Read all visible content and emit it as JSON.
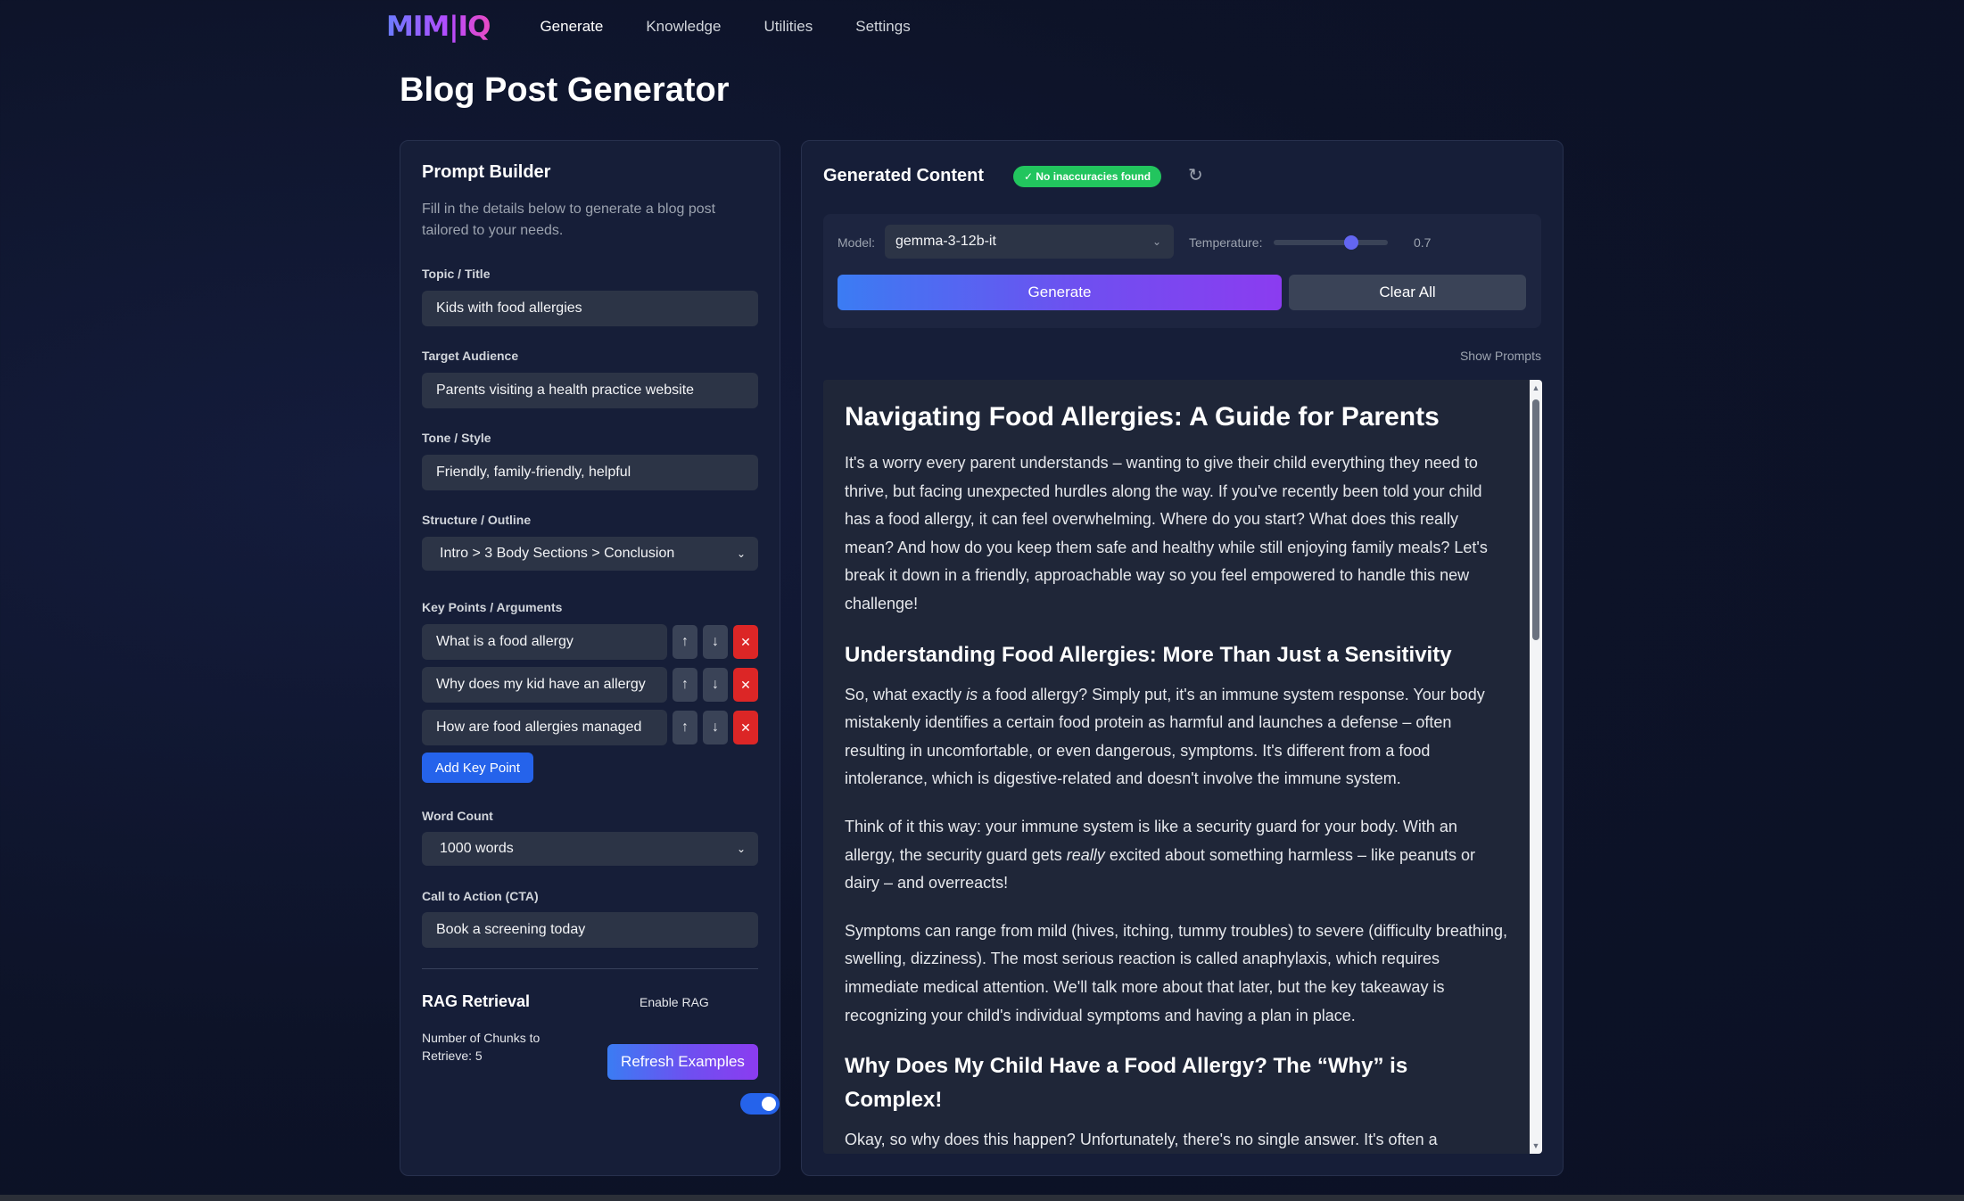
{
  "nav": {
    "logo": "MIM|IQ",
    "items": [
      "Generate",
      "Knowledge",
      "Utilities",
      "Settings"
    ]
  },
  "page_title": "Blog Post Generator",
  "prompt_builder": {
    "title": "Prompt Builder",
    "description": "Fill in the details below to generate a blog post tailored to your needs.",
    "topic_label": "Topic / Title",
    "topic_value": "Kids with food allergies",
    "audience_label": "Target Audience",
    "audience_value": "Parents visiting a health practice website",
    "tone_label": "Tone / Style",
    "tone_value": "Friendly, family-friendly, helpful",
    "structure_label": "Structure / Outline",
    "structure_value": "Intro > 3 Body Sections > Conclusion",
    "keypoints_label": "Key Points / Arguments",
    "keypoints": [
      "What is a food allergy",
      "Why does my kid have an allergy",
      "How are food allergies managed"
    ],
    "add_keypoint_label": "Add Key Point",
    "wordcount_label": "Word Count",
    "wordcount_value": "1000 words",
    "cta_label": "Call to Action (CTA)",
    "cta_value": "Book a screening today"
  },
  "rag": {
    "title": "RAG Retrieval",
    "enable_label": "Enable RAG",
    "enabled": true,
    "chunks_label": "Number of Chunks to Retrieve: 5",
    "chunks_value": 5,
    "refresh_label": "Refresh Examples"
  },
  "generated": {
    "title": "Generated Content",
    "badge": "✓ No inaccuracies found",
    "model_label": "Model:",
    "model_value": "gemma-3-12b-it",
    "temperature_label": "Temperature:",
    "temperature_value": "0.7",
    "generate_label": "Generate",
    "clear_label": "Clear All",
    "show_prompts_label": "Show Prompts"
  },
  "article": {
    "h1": "Navigating Food Allergies: A Guide for Parents",
    "p1": "It's a worry every parent understands – wanting to give their child everything they need to thrive, but facing unexpected hurdles along the way. If you've recently been told your child has a food allergy, it can feel overwhelming. Where do you start? What does this really mean? And how do you keep them safe and healthy while still enjoying family meals? Let's break it down in a friendly, approachable way so you feel empowered to handle this new challenge!",
    "h2a": "Understanding Food Allergies: More Than Just a Sensitivity",
    "p2_pre": "So, what exactly ",
    "p2_em": "is",
    "p2_post": " a food allergy? Simply put, it's an immune system response. Your body mistakenly identifies a certain food protein as harmful and launches a defense – often resulting in uncomfortable, or even dangerous, symptoms. It's different from a food intolerance, which is digestive-related and doesn't involve the immune system.",
    "p3_pre": "Think of it this way: your immune system is like a security guard for your body. With an allergy, the security guard gets ",
    "p3_em": "really",
    "p3_post": " excited about something harmless – like peanuts or dairy – and overreacts!",
    "p4": "Symptoms can range from mild (hives, itching, tummy troubles) to severe (difficulty breathing, swelling, dizziness). The most serious reaction is called anaphylaxis, which requires immediate medical attention. We'll talk more about that later, but the key takeaway is recognizing your child's individual symptoms and having a plan in place.",
    "h2b": "Why Does My Child Have a Food Allergy? The “Why” is Complex!",
    "p5": "Okay, so why does this happen? Unfortunately, there's no single answer. It's often a"
  }
}
